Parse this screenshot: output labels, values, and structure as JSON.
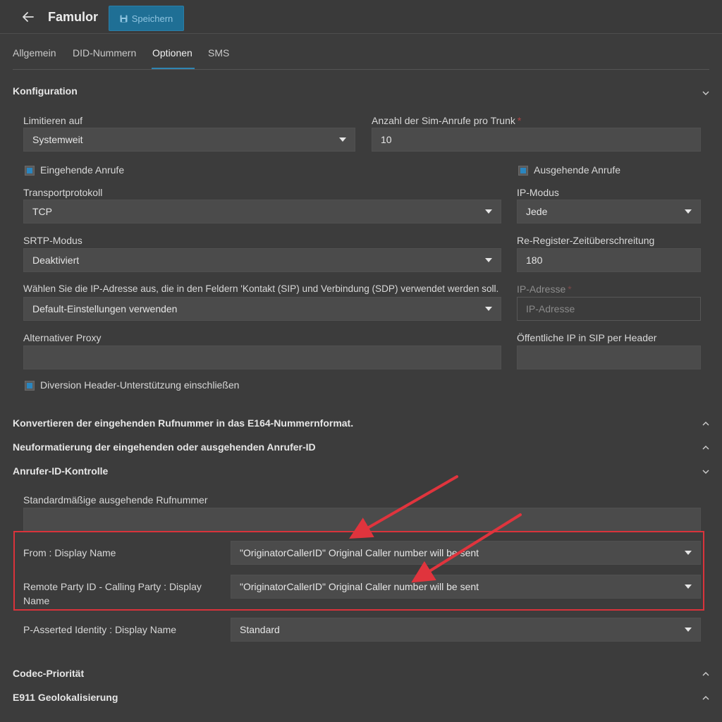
{
  "header": {
    "title": "Famulor",
    "save_label": "Speichern"
  },
  "tabs": [
    {
      "label": "Allgemein"
    },
    {
      "label": "DID-Nummern"
    },
    {
      "label": "Optionen",
      "active": true
    },
    {
      "label": "SMS"
    }
  ],
  "sections": {
    "konfiguration": "Konfiguration",
    "e164": "Konvertieren der eingehenden Rufnummer in das E164-Nummernformat.",
    "reformat": "Neuformatierung der eingehenden oder ausgehenden Anrufer-ID",
    "caller_id": "Anrufer-ID-Kontrolle",
    "codec": "Codec-Priorität",
    "e911": "E911 Geolokalisierung"
  },
  "config": {
    "limit_label": "Limitieren auf",
    "limit_value": "Systemweit",
    "sim_calls_label": "Anzahl der Sim-Anrufe pro Trunk",
    "sim_calls_required": "*",
    "sim_calls_value": "10",
    "incoming_calls_label": "Eingehende Anrufe",
    "incoming_calls_checked": true,
    "outgoing_calls_label": "Ausgehende Anrufe",
    "outgoing_calls_checked": true,
    "transport_label": "Transportprotokoll",
    "transport_value": "TCP",
    "ip_mode_label": "IP-Modus",
    "ip_mode_value": "Jede",
    "srtp_label": "SRTP-Modus",
    "srtp_value": "Deaktiviert",
    "reregister_label": "Re-Register-Zeitüberschreitung",
    "reregister_value": "180",
    "ip_select_label": "Wählen Sie die IP-Adresse aus, die in den Feldern 'Kontakt (SIP) und Verbindung (SDP) verwendet werden soll.",
    "ip_select_value": "Default-Einstellungen verwenden",
    "ip_address_label": "IP-Adresse",
    "ip_address_required": "*",
    "ip_address_placeholder": "IP-Adresse",
    "alt_proxy_label": "Alternativer Proxy",
    "alt_proxy_value": "",
    "public_ip_label": "Öffentliche IP in SIP per Header",
    "public_ip_value": "",
    "diversion_label": "Diversion Header-Unterstützung einschließen",
    "diversion_checked": true
  },
  "caller_id": {
    "default_outgoing_label": "Standardmäßige ausgehende Rufnummer",
    "default_outgoing_value": "",
    "from_display_label": "From : Display Name",
    "from_display_value": "\"OriginatorCallerID\" Original Caller number will be sent",
    "rpid_label_line1": "Remote Party ID - Calling Party : Display",
    "rpid_label_line2": "Name",
    "rpid_value": "\"OriginatorCallerID\" Original Caller number will be sent",
    "pai_label": "P-Asserted Identity : Display Name",
    "pai_value": "Standard"
  },
  "colors": {
    "background": "#3c3c3c",
    "field": "#4b4b4b",
    "accent": "#2f86b3",
    "save_button": "#1f6f95",
    "annotation": "#d9333b"
  }
}
